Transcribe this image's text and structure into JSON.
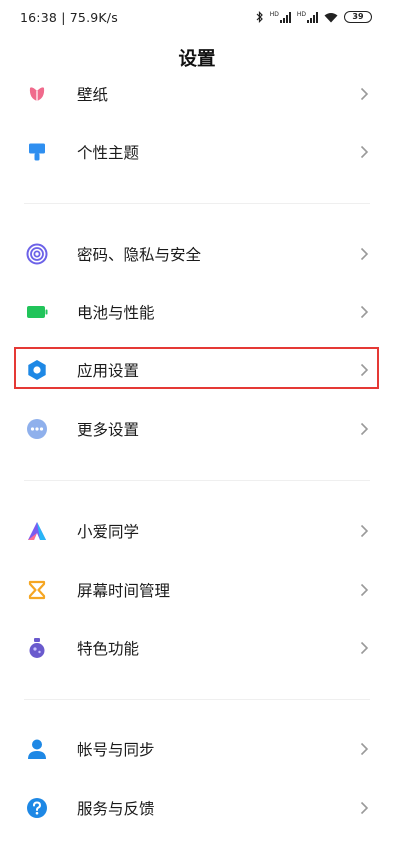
{
  "status": {
    "time_speed": "16:38 | 75.9K/s",
    "battery": "39",
    "hd": "HD"
  },
  "header": {
    "title": "设置"
  },
  "items": [
    {
      "label": "壁纸",
      "icon": "wallpaper-tulip-icon",
      "color": "#f06a8c"
    },
    {
      "label": "个性主题",
      "icon": "theme-brush-icon",
      "color": "#2f8ff0"
    },
    {
      "label": "密码、隐私与安全",
      "icon": "fingerprint-icon",
      "color": "#6c62e8"
    },
    {
      "label": "电池与性能",
      "icon": "battery-icon",
      "color": "#21c45a"
    },
    {
      "label": "应用设置",
      "icon": "gear-icon",
      "color": "#1e88e5"
    },
    {
      "label": "更多设置",
      "icon": "more-dots-icon",
      "color": "#7fa3e8"
    },
    {
      "label": "小爱同学",
      "icon": "xiaoai-icon",
      "color": "#7b5cf0"
    },
    {
      "label": "屏幕时间管理",
      "icon": "hourglass-icon",
      "color": "#f5a623"
    },
    {
      "label": "特色功能",
      "icon": "features-flask-icon",
      "color": "#6a5acd"
    },
    {
      "label": "帐号与同步",
      "icon": "account-person-icon",
      "color": "#1e88e5"
    },
    {
      "label": "服务与反馈",
      "icon": "help-question-icon",
      "color": "#1e88e5"
    }
  ],
  "highlight": {
    "color": "#e53935",
    "target": "应用设置"
  }
}
